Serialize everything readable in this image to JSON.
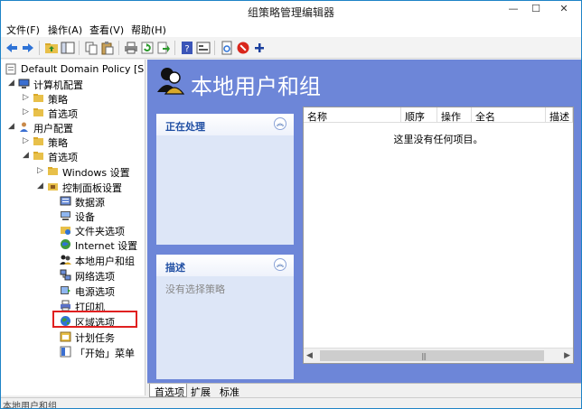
{
  "window": {
    "title": "组策略管理编辑器",
    "controls": {
      "minimize": "—",
      "maximize": "☐",
      "close": "✕"
    }
  },
  "menu": [
    "文件(F)",
    "操作(A)",
    "查看(V)",
    "帮助(H)"
  ],
  "toolbar_icons": [
    "back-icon",
    "forward-icon",
    "folder-up-icon",
    "show-tree-icon",
    "copy-icon",
    "paste-icon",
    "print-icon",
    "refresh-icon",
    "export-icon",
    "help-icon",
    "properties-icon",
    "new-item-icon",
    "stop-icon",
    "add-icon"
  ],
  "tree": {
    "root": "Default Domain Policy [SERV",
    "computer_config": "计算机配置",
    "cc_policies": "策略",
    "cc_preferences": "首选项",
    "user_config": "用户配置",
    "uc_policies": "策略",
    "uc_preferences": "首选项",
    "windows_settings": "Windows 设置",
    "control_panel_settings": "控制面板设置",
    "items": [
      "数据源",
      "设备",
      "文件夹选项",
      "Internet 设置",
      "本地用户和组",
      "网络选项",
      "电源选项",
      "打印机",
      "区域选项",
      "计划任务",
      "「开始」菜单"
    ]
  },
  "main": {
    "title": "本地用户和组",
    "processing_panel": {
      "title": "正在处理"
    },
    "description_panel": {
      "title": "描述",
      "body": "没有选择策略"
    },
    "columns": [
      "名称",
      "顺序",
      "操作",
      "全名",
      "描述"
    ],
    "empty_message": "这里没有任何项目。"
  },
  "tabs": [
    "首选项",
    "扩展",
    "标准"
  ],
  "status": "本地用户和组",
  "colors": {
    "accent": "#6d86d8",
    "panel": "#dde6f7",
    "panel_title": "#1f4ea3",
    "highlight": "#e02020"
  }
}
